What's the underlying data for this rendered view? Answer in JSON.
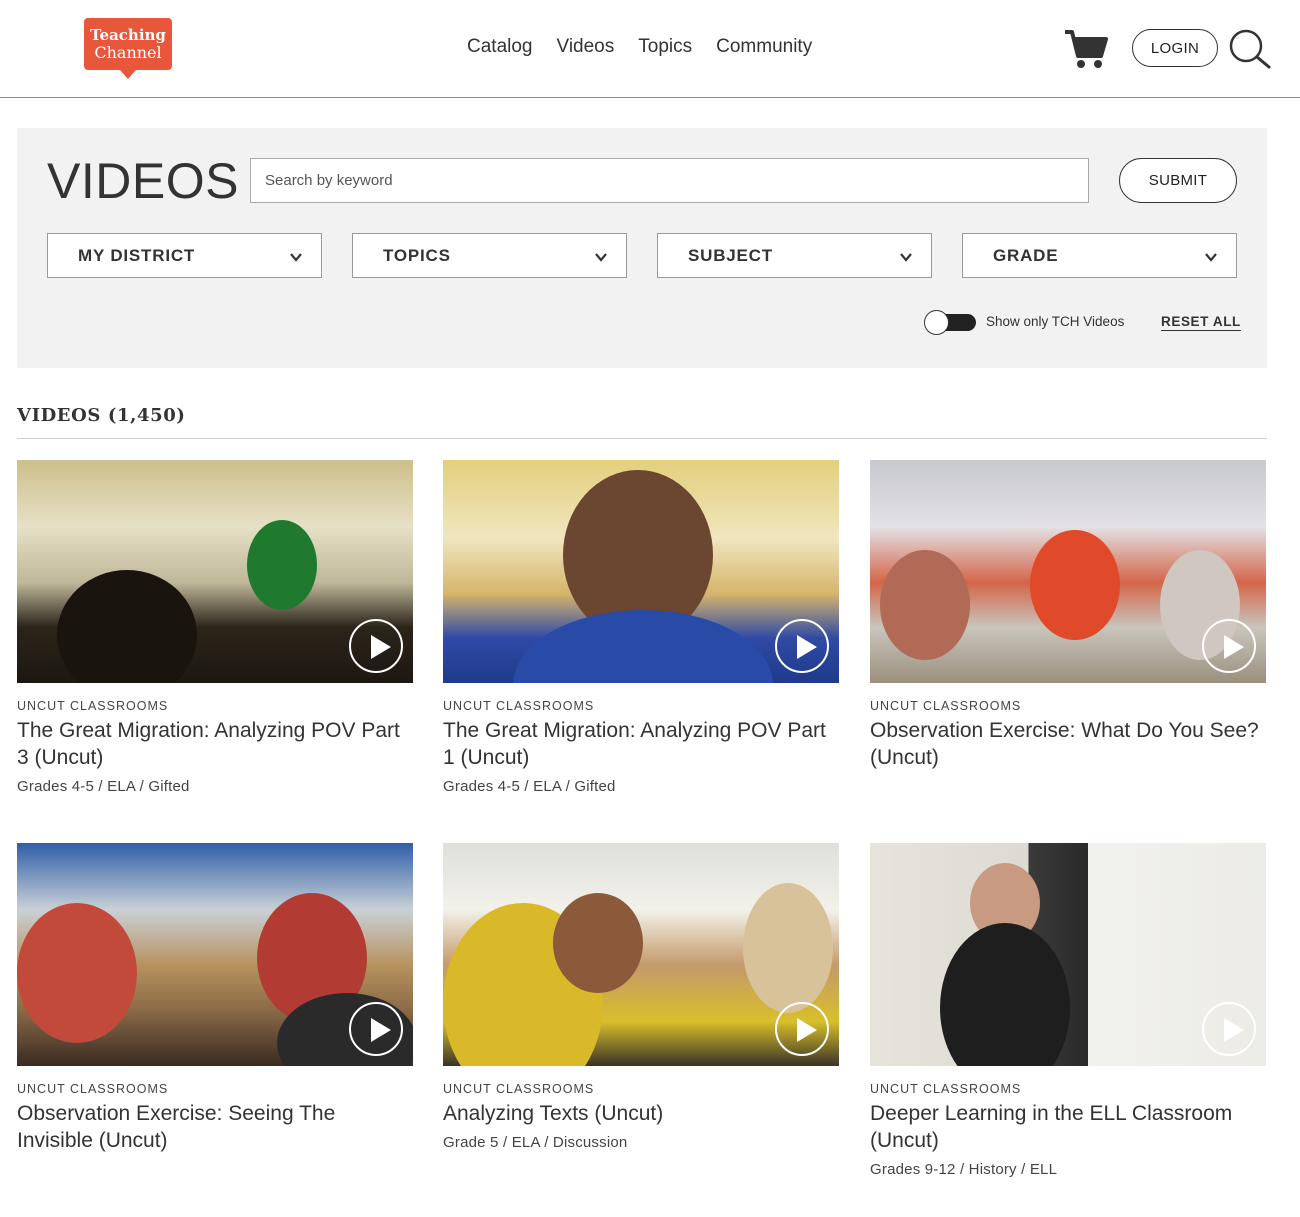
{
  "header": {
    "logo_line1": "Teaching",
    "logo_line2": "Channel",
    "nav": [
      "Catalog",
      "Videos",
      "Topics",
      "Community"
    ],
    "login_label": "LOGIN",
    "icons": {
      "cart": "cart-icon",
      "search": "search-icon"
    }
  },
  "filters": {
    "title": "VIDEOS",
    "search_placeholder": "Search by keyword",
    "submit_label": "SUBMIT",
    "selects": [
      "MY DISTRICT",
      "TOPICS",
      "SUBJECT",
      "GRADE"
    ],
    "toggle_label": "Show only TCH Videos",
    "toggle_on": false,
    "reset_label": "RESET ALL"
  },
  "results": {
    "count_label": "VIDEOS (1,450)",
    "cards": [
      {
        "category": "UNCUT CLASSROOMS",
        "title": "The Great Migration: Analyzing POV Part 3 (Uncut)",
        "meta": "Grades 4-5 / ELA / Gifted"
      },
      {
        "category": "UNCUT CLASSROOMS",
        "title": "The Great Migration: Analyzing POV Part 1 (Uncut)",
        "meta": "Grades 4-5 / ELA / Gifted"
      },
      {
        "category": "UNCUT CLASSROOMS",
        "title": "Observation Exercise: What Do You See? (Uncut)",
        "meta": ""
      },
      {
        "category": "UNCUT CLASSROOMS",
        "title": "Observation Exercise: Seeing The Invisible (Uncut)",
        "meta": ""
      },
      {
        "category": "UNCUT CLASSROOMS",
        "title": "Analyzing Texts (Uncut)",
        "meta": "Grade 5 / ELA / Discussion"
      },
      {
        "category": "UNCUT CLASSROOMS",
        "title": "Deeper Learning in the ELL Classroom (Uncut)",
        "meta": "Grades 9-12 / History / ELL"
      }
    ]
  },
  "colors": {
    "brand": "#e8573a",
    "panel": "#f2f2f2",
    "text": "#333333"
  }
}
